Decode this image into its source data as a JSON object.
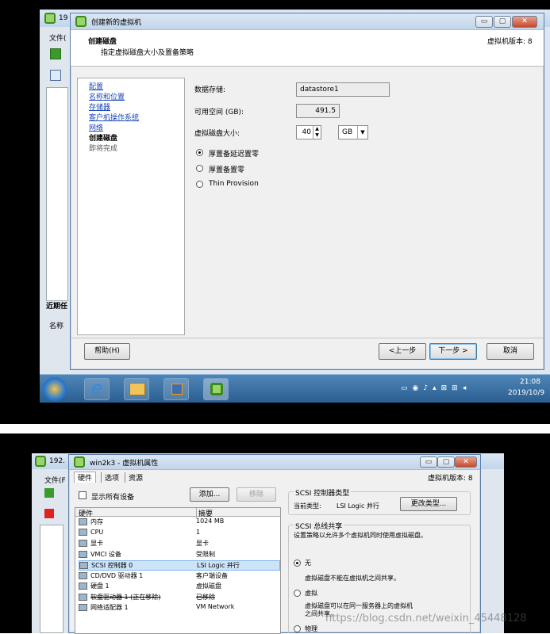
{
  "screen1": {
    "window": {
      "title": "创建新的虚拟机",
      "minimize": "▭",
      "maximize": "▢",
      "close": "✕"
    },
    "behind": {
      "title_fragment": "19",
      "menu_file": "文件(",
      "recent_label": "近期任",
      "col_name": "名称"
    },
    "header": {
      "title": "创建磁盘",
      "subtitle": "指定虚拟磁盘大小及置备策略",
      "version": "虚拟机版本: 8"
    },
    "steps": [
      {
        "label": "配置",
        "type": "link"
      },
      {
        "label": "名称和位置",
        "type": "link"
      },
      {
        "label": "存储器",
        "type": "link"
      },
      {
        "label": "客户机操作系统",
        "type": "link"
      },
      {
        "label": "网络",
        "type": "link"
      },
      {
        "label": "创建磁盘",
        "type": "current"
      },
      {
        "label": "即将完成",
        "type": "pending"
      }
    ],
    "form": {
      "datastore_label": "数据存储:",
      "datastore_value": "datastore1",
      "free_label": "可用空间 (GB):",
      "free_value": "491.5",
      "size_label": "虚拟磁盘大小:",
      "size_value": "40",
      "unit_value": "GB",
      "opt_lazy": "厚置备延迟置零",
      "opt_eager": "厚置备置零",
      "opt_thin": "Thin Provision",
      "selected": "lazy"
    },
    "buttons": {
      "help": "帮助(H)",
      "back": "<上一步",
      "next": "下一步 >",
      "cancel": "取消"
    },
    "taskbar": {
      "time": "21:08",
      "date": "2019/10/9"
    }
  },
  "screen2": {
    "window": {
      "title": "win2k3 - 虚拟机属性",
      "minimize": "▭",
      "maximize": "▢",
      "close": "✕"
    },
    "behind": {
      "title_fragment": "192.",
      "menu_file": "文件(F"
    },
    "version": "虚拟机版本: 8",
    "tabs": [
      "硬件",
      "选项",
      "资源"
    ],
    "show_all": "显示所有设备",
    "add_button": "添加...",
    "remove_button": "移除",
    "columns": {
      "hardware": "硬件",
      "summary": "摘要"
    },
    "devices": [
      {
        "name": "内存",
        "summary": "1024 MB",
        "icon": "memory-icon"
      },
      {
        "name": "CPU",
        "summary": "1",
        "icon": "cpu-icon"
      },
      {
        "name": "显卡",
        "summary": "显卡",
        "icon": "display-icon"
      },
      {
        "name": "VMCI 设备",
        "summary": "受限制",
        "icon": "vmci-icon"
      },
      {
        "name": "SCSI 控制器 0",
        "summary": "LSI Logic 并行",
        "icon": "scsi-icon"
      },
      {
        "name": "CD/DVD 驱动器 1",
        "summary": "客户端设备",
        "icon": "cdrom-icon"
      },
      {
        "name": "硬盘 1",
        "summary": "虚拟磁盘",
        "icon": "harddisk-icon"
      },
      {
        "name": "软盘驱动器 1 (正在移除)",
        "summary": "已移除",
        "icon": "floppy-icon"
      },
      {
        "name": "网络适配器 1",
        "summary": "VM Network",
        "icon": "network-icon"
      }
    ],
    "selected_index": 4,
    "scsi_type": {
      "group": "SCSI 控制器类型",
      "current_label": "当前类型:",
      "current_value": "LSI Logic 并行",
      "change_button": "更改类型..."
    },
    "bus_sharing": {
      "group": "SCSI 总线共享",
      "desc": "设置策略以允许多个虚拟机同时使用虚拟磁盘。",
      "opt_none": "无",
      "opt_none_desc": "虚拟磁盘不能在虚拟机之间共享。",
      "opt_virtual": "虚拟",
      "opt_virtual_desc1": "虚拟磁盘可以在同一服务器上的虚拟机",
      "opt_virtual_desc2": "之间共享。",
      "opt_physical": "物理",
      "selected": "none"
    },
    "watermark": "https://blog.csdn.net/weixin_45448128"
  }
}
